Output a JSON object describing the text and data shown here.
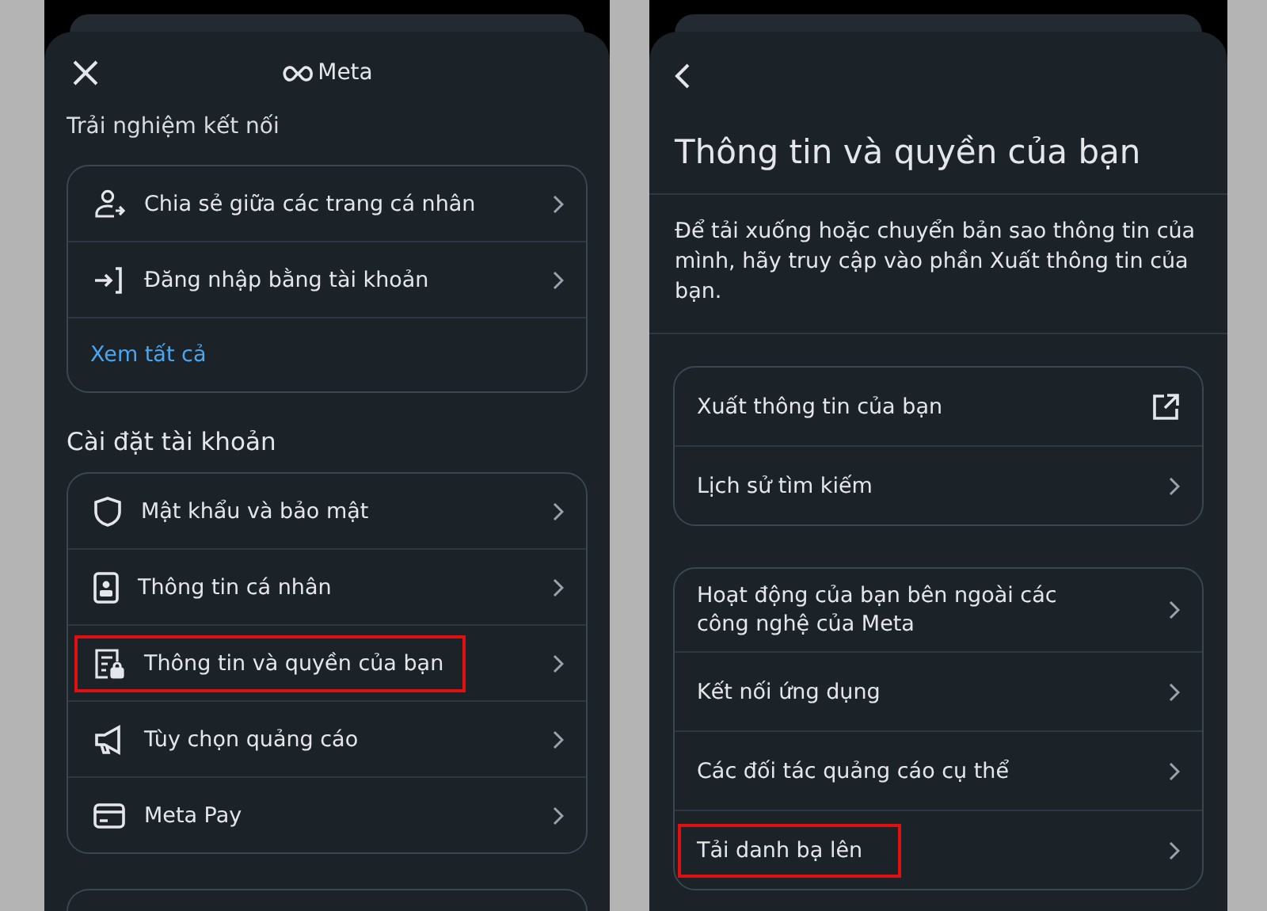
{
  "left_screen": {
    "header": {
      "brand": "Meta"
    },
    "section_label": "Trải nghiệm kết nối",
    "connected_items": [
      {
        "label": "Chia sẻ giữa các trang cá nhân",
        "kind": "person-share",
        "highlighted": false
      },
      {
        "label": "Đăng nhập bằng tài khoản",
        "kind": "login",
        "highlighted": false
      }
    ],
    "see_all": "Xem tất cả",
    "account_heading": "Cài đặt tài khoản",
    "account_items": [
      {
        "label": "Mật khẩu và bảo mật",
        "kind": "shield",
        "highlighted": false
      },
      {
        "label": "Thông tin cá nhân",
        "kind": "id-card",
        "highlighted": false
      },
      {
        "label": "Thông tin và quyền của bạn",
        "kind": "doc-lock",
        "highlighted": true
      },
      {
        "label": "Tùy chọn quảng cáo",
        "kind": "megaphone",
        "highlighted": false
      },
      {
        "label": "Meta Pay",
        "kind": "card",
        "highlighted": false
      }
    ]
  },
  "right_screen": {
    "title": "Thông tin và quyền của bạn",
    "description": "Để tải xuống hoặc chuyển bản sao thông tin của mình, hãy truy cập vào phần Xuất thông tin của bạn.",
    "export_items": [
      {
        "label": "Xuất thông tin của bạn",
        "kind": "external",
        "highlighted": false
      },
      {
        "label": "Lịch sử tìm kiếm",
        "kind": "chevron",
        "highlighted": false
      }
    ],
    "more_items": [
      {
        "label": "Hoạt động của bạn bên ngoài các công nghệ của Meta",
        "kind": "chevron",
        "highlighted": false
      },
      {
        "label": "Kết nối ứng dụng",
        "kind": "chevron",
        "highlighted": false
      },
      {
        "label": "Các đối tác quảng cáo cụ thể",
        "kind": "chevron",
        "highlighted": false
      },
      {
        "label": "Tải danh bạ lên",
        "kind": "chevron",
        "highlighted": true
      }
    ]
  }
}
